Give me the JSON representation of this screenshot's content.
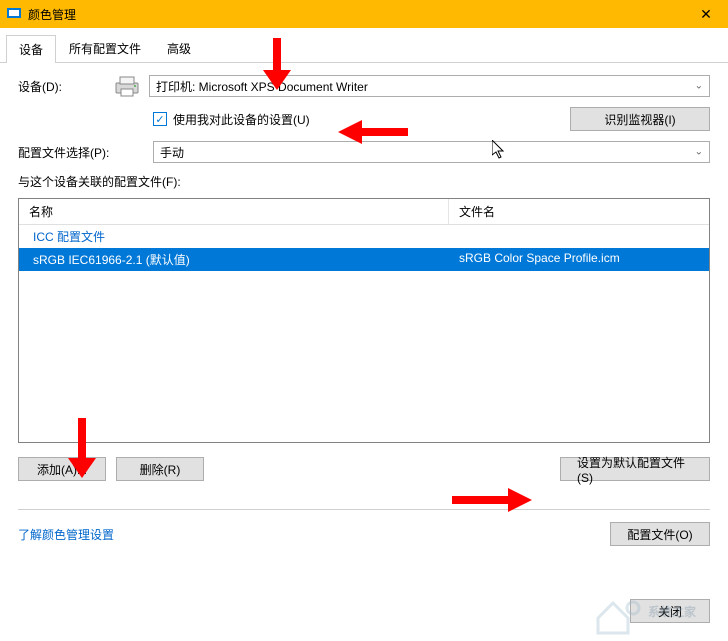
{
  "window": {
    "title": "颜色管理"
  },
  "tabs": {
    "device": "设备",
    "all_profiles": "所有配置文件",
    "advanced": "高级"
  },
  "labels": {
    "device": "设备(D):",
    "profile_select": "配置文件选择(P):",
    "associated": "与这个设备关联的配置文件(F):"
  },
  "device_select": {
    "value": "打印机: Microsoft XPS Document Writer"
  },
  "checkbox": {
    "label": "使用我对此设备的设置(U)"
  },
  "profile_select": {
    "value": "手动"
  },
  "buttons": {
    "identify": "识别监视器(I)",
    "add": "添加(A)...",
    "remove": "删除(R)",
    "set_default": "设置为默认配置文件(S)",
    "profiles": "配置文件(O)",
    "close": "关闭"
  },
  "table": {
    "headers": {
      "name": "名称",
      "file": "文件名"
    },
    "group": "ICC 配置文件",
    "rows": [
      {
        "name": "sRGB IEC61966-2.1 (默认值)",
        "file": "sRGB Color Space Profile.icm"
      }
    ]
  },
  "link": "了解颜色管理设置",
  "watermark": "系统之家"
}
